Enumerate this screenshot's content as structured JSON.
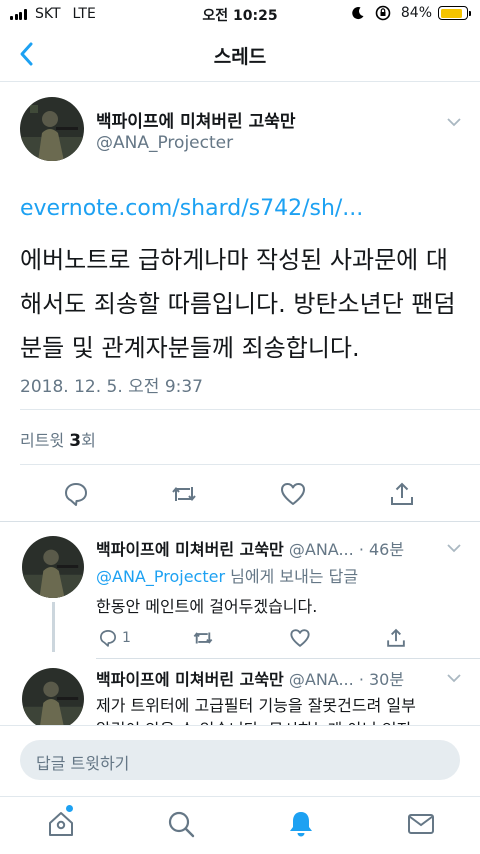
{
  "status_bar": {
    "carrier": "SKT",
    "network": "LTE",
    "time": "오전 10:25",
    "battery_percent": "84%",
    "battery_level": 0.84
  },
  "nav": {
    "title": "스레드",
    "back_icon": "chevron-left-icon"
  },
  "main_tweet": {
    "author_name": "백파이프에 미쳐버린 고쑥만",
    "author_handle": "@ANA_Projecter",
    "link_text": "evernote.com/shard/s742/sh/...",
    "body": "에버노트로 급하게나마 작성된 사과문에 대해서도 죄송할 따름입니다. 방탄소년단 팬덤분들 및 관계자분들께 죄송합니다.",
    "timestamp": "2018. 12. 5. 오전 9:37",
    "retweet_label": "리트윗",
    "retweet_count": "3",
    "retweet_unit": "회"
  },
  "replies": [
    {
      "author_name": "백파이프에 미쳐버린 고쑥만",
      "author_handle": "@ANA...",
      "ago": "· 46분",
      "reply_to_handle": "@ANA_Projecter",
      "reply_to_suffix": " 님에게 보내는 답글",
      "body": "한동안 메인트에 걸어두겠습니다.",
      "reply_count": "1"
    },
    {
      "author_name": "백파이프에 미쳐버린 고쑥만",
      "author_handle": "@ANA...",
      "ago": "· 30분",
      "body_line1": "제가 트위터에 고급필터 기능을 잘못건드려 일부",
      "body_line2": "알림이 안올 수 있습니다. 무시하는게 아닌 인지"
    }
  ],
  "composer": {
    "placeholder": "답글 트윗하기"
  },
  "tabbar": {
    "items": [
      "home-icon",
      "search-icon",
      "notifications-icon",
      "messages-icon"
    ],
    "active": "notifications-icon"
  },
  "colors": {
    "accent": "#1da1f2",
    "secondary_text": "#657786",
    "primary_text": "#14171a",
    "composer_bg": "#e6ecf0"
  }
}
